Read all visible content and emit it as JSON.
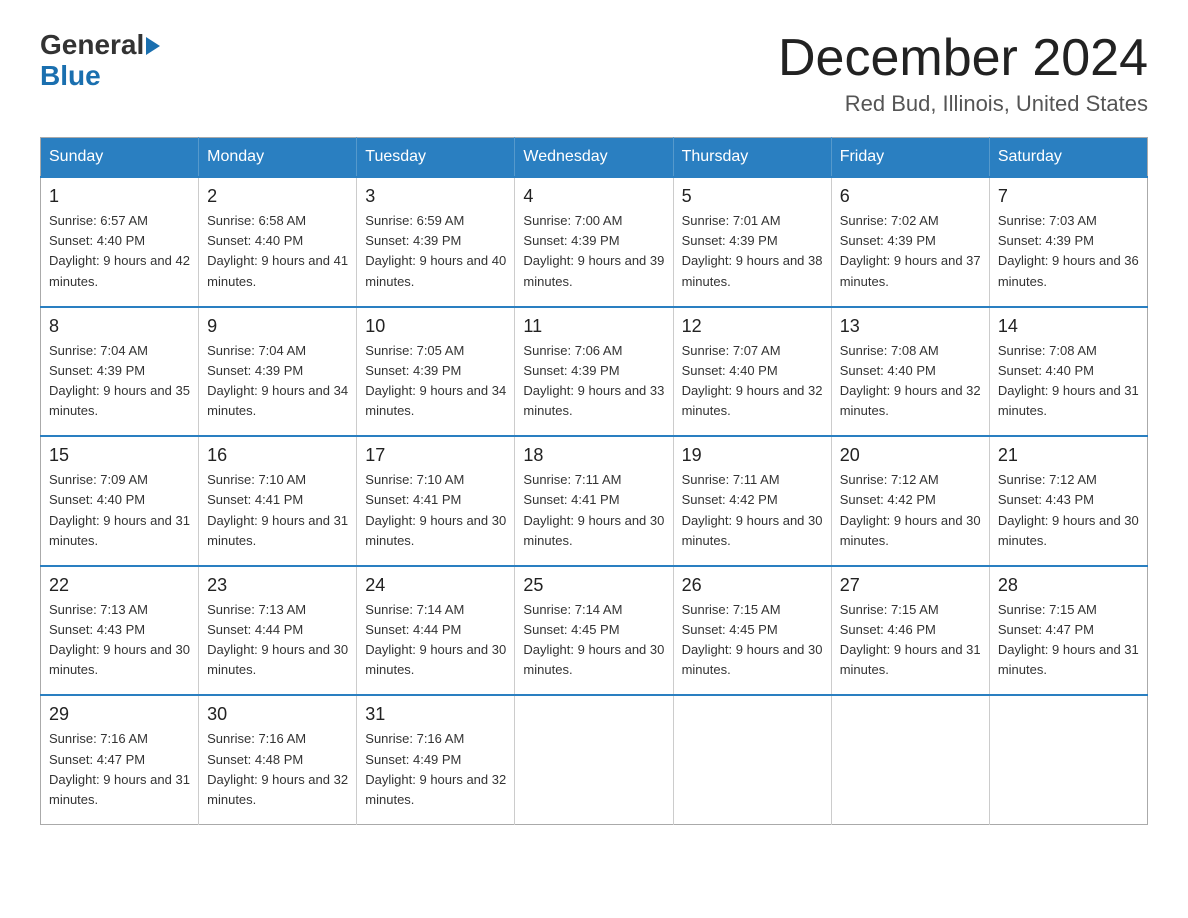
{
  "logo": {
    "text_general": "General",
    "text_blue": "Blue",
    "arrow": "▶"
  },
  "title": "December 2024",
  "subtitle": "Red Bud, Illinois, United States",
  "days_of_week": [
    "Sunday",
    "Monday",
    "Tuesday",
    "Wednesday",
    "Thursday",
    "Friday",
    "Saturday"
  ],
  "weeks": [
    [
      {
        "day": "1",
        "sunrise": "6:57 AM",
        "sunset": "4:40 PM",
        "daylight": "9 hours and 42 minutes."
      },
      {
        "day": "2",
        "sunrise": "6:58 AM",
        "sunset": "4:40 PM",
        "daylight": "9 hours and 41 minutes."
      },
      {
        "day": "3",
        "sunrise": "6:59 AM",
        "sunset": "4:39 PM",
        "daylight": "9 hours and 40 minutes."
      },
      {
        "day": "4",
        "sunrise": "7:00 AM",
        "sunset": "4:39 PM",
        "daylight": "9 hours and 39 minutes."
      },
      {
        "day": "5",
        "sunrise": "7:01 AM",
        "sunset": "4:39 PM",
        "daylight": "9 hours and 38 minutes."
      },
      {
        "day": "6",
        "sunrise": "7:02 AM",
        "sunset": "4:39 PM",
        "daylight": "9 hours and 37 minutes."
      },
      {
        "day": "7",
        "sunrise": "7:03 AM",
        "sunset": "4:39 PM",
        "daylight": "9 hours and 36 minutes."
      }
    ],
    [
      {
        "day": "8",
        "sunrise": "7:04 AM",
        "sunset": "4:39 PM",
        "daylight": "9 hours and 35 minutes."
      },
      {
        "day": "9",
        "sunrise": "7:04 AM",
        "sunset": "4:39 PM",
        "daylight": "9 hours and 34 minutes."
      },
      {
        "day": "10",
        "sunrise": "7:05 AM",
        "sunset": "4:39 PM",
        "daylight": "9 hours and 34 minutes."
      },
      {
        "day": "11",
        "sunrise": "7:06 AM",
        "sunset": "4:39 PM",
        "daylight": "9 hours and 33 minutes."
      },
      {
        "day": "12",
        "sunrise": "7:07 AM",
        "sunset": "4:40 PM",
        "daylight": "9 hours and 32 minutes."
      },
      {
        "day": "13",
        "sunrise": "7:08 AM",
        "sunset": "4:40 PM",
        "daylight": "9 hours and 32 minutes."
      },
      {
        "day": "14",
        "sunrise": "7:08 AM",
        "sunset": "4:40 PM",
        "daylight": "9 hours and 31 minutes."
      }
    ],
    [
      {
        "day": "15",
        "sunrise": "7:09 AM",
        "sunset": "4:40 PM",
        "daylight": "9 hours and 31 minutes."
      },
      {
        "day": "16",
        "sunrise": "7:10 AM",
        "sunset": "4:41 PM",
        "daylight": "9 hours and 31 minutes."
      },
      {
        "day": "17",
        "sunrise": "7:10 AM",
        "sunset": "4:41 PM",
        "daylight": "9 hours and 30 minutes."
      },
      {
        "day": "18",
        "sunrise": "7:11 AM",
        "sunset": "4:41 PM",
        "daylight": "9 hours and 30 minutes."
      },
      {
        "day": "19",
        "sunrise": "7:11 AM",
        "sunset": "4:42 PM",
        "daylight": "9 hours and 30 minutes."
      },
      {
        "day": "20",
        "sunrise": "7:12 AM",
        "sunset": "4:42 PM",
        "daylight": "9 hours and 30 minutes."
      },
      {
        "day": "21",
        "sunrise": "7:12 AM",
        "sunset": "4:43 PM",
        "daylight": "9 hours and 30 minutes."
      }
    ],
    [
      {
        "day": "22",
        "sunrise": "7:13 AM",
        "sunset": "4:43 PM",
        "daylight": "9 hours and 30 minutes."
      },
      {
        "day": "23",
        "sunrise": "7:13 AM",
        "sunset": "4:44 PM",
        "daylight": "9 hours and 30 minutes."
      },
      {
        "day": "24",
        "sunrise": "7:14 AM",
        "sunset": "4:44 PM",
        "daylight": "9 hours and 30 minutes."
      },
      {
        "day": "25",
        "sunrise": "7:14 AM",
        "sunset": "4:45 PM",
        "daylight": "9 hours and 30 minutes."
      },
      {
        "day": "26",
        "sunrise": "7:15 AM",
        "sunset": "4:45 PM",
        "daylight": "9 hours and 30 minutes."
      },
      {
        "day": "27",
        "sunrise": "7:15 AM",
        "sunset": "4:46 PM",
        "daylight": "9 hours and 31 minutes."
      },
      {
        "day": "28",
        "sunrise": "7:15 AM",
        "sunset": "4:47 PM",
        "daylight": "9 hours and 31 minutes."
      }
    ],
    [
      {
        "day": "29",
        "sunrise": "7:16 AM",
        "sunset": "4:47 PM",
        "daylight": "9 hours and 31 minutes."
      },
      {
        "day": "30",
        "sunrise": "7:16 AM",
        "sunset": "4:48 PM",
        "daylight": "9 hours and 32 minutes."
      },
      {
        "day": "31",
        "sunrise": "7:16 AM",
        "sunset": "4:49 PM",
        "daylight": "9 hours and 32 minutes."
      },
      null,
      null,
      null,
      null
    ]
  ]
}
